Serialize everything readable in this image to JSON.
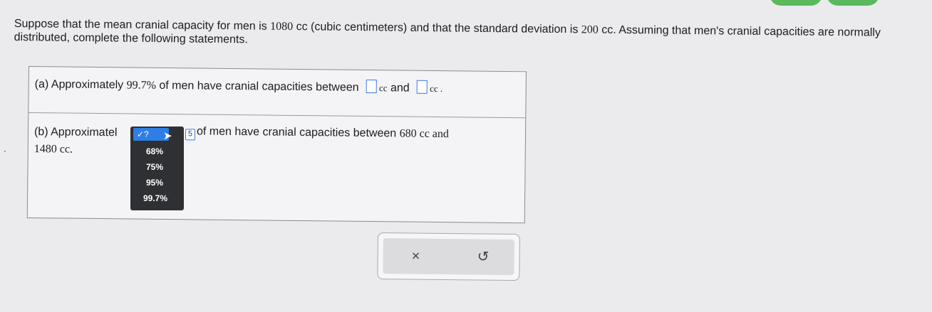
{
  "question": {
    "text_part1": "Suppose that the mean cranial capacity for men is ",
    "mean": "1080",
    "text_part2": " cc (cubic centimeters) and that the standard deviation is ",
    "sd": "200",
    "text_part3": " cc. Assuming that men's cranial capacities are normally distributed, complete the following statements."
  },
  "part_a": {
    "prefix": "(a) Approximately ",
    "percent": "99.7%",
    "middle": " of men have cranial capacities between ",
    "unit1": "cc",
    "and": " and ",
    "unit2": "cc ."
  },
  "part_b": {
    "prefix": "(b) Approximatel",
    "blank_text": "5",
    "rest": "of men have cranial capacities between ",
    "low": "680",
    "unit_low": " cc and",
    "high": "1480",
    "unit_high": " cc."
  },
  "dropdown": {
    "selected": "✓?",
    "options": [
      "68%",
      "75%",
      "95%",
      "99.7%"
    ]
  },
  "actions": {
    "clear_icon": "×",
    "undo_icon": "↺"
  }
}
